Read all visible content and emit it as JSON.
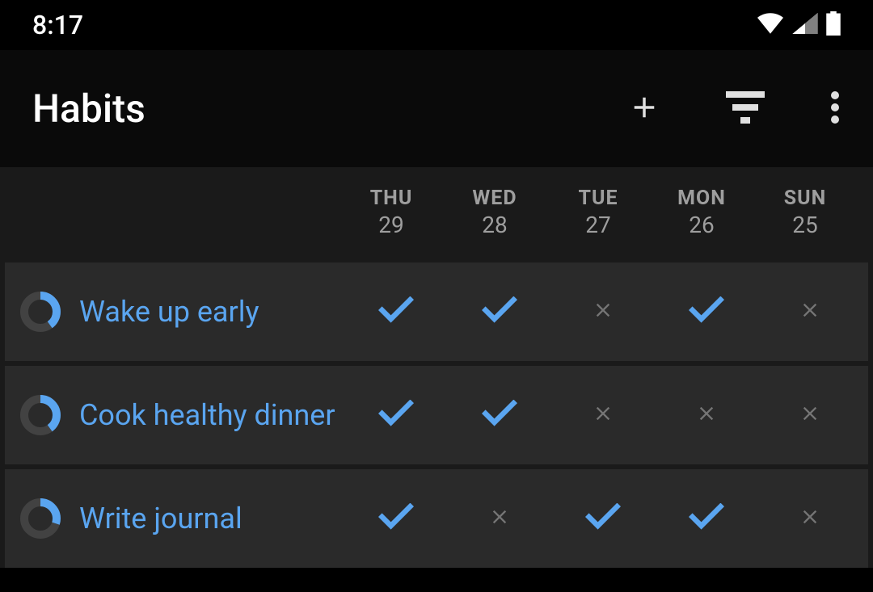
{
  "status": {
    "time": "8:17"
  },
  "appbar": {
    "title": "Habits"
  },
  "days": [
    {
      "label": "THU",
      "num": "29"
    },
    {
      "label": "WED",
      "num": "28"
    },
    {
      "label": "TUE",
      "num": "27"
    },
    {
      "label": "MON",
      "num": "26"
    },
    {
      "label": "SUN",
      "num": "25"
    }
  ],
  "habits": [
    {
      "name": "Wake up early",
      "progress": 0.4,
      "marks": [
        "check",
        "check",
        "cross",
        "check",
        "cross"
      ]
    },
    {
      "name": "Cook healthy dinner",
      "progress": 0.4,
      "marks": [
        "check",
        "check",
        "cross",
        "cross",
        "cross"
      ]
    },
    {
      "name": "Write journal",
      "progress": 0.3,
      "marks": [
        "check",
        "cross",
        "check",
        "check",
        "cross"
      ]
    }
  ],
  "colors": {
    "accent": "#5aa5f0"
  }
}
